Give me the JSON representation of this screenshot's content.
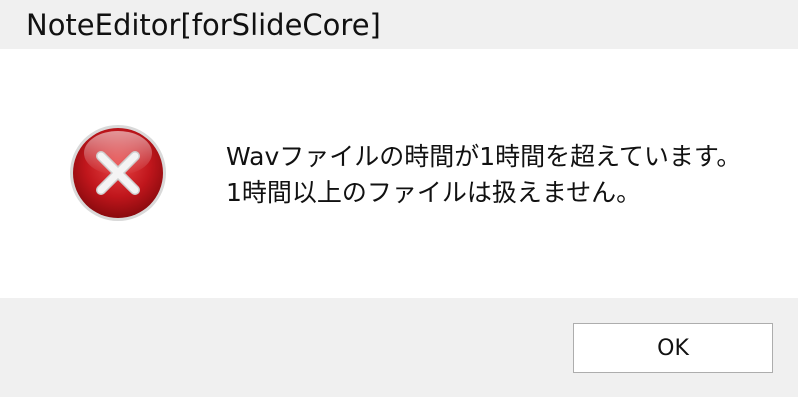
{
  "window": {
    "title": "NoteEditor[forSlideCore]"
  },
  "message": {
    "line1": "Wavファイルの時間が1時間を超えています。",
    "line2": "1時間以上のファイルは扱えません。"
  },
  "buttons": {
    "ok_label": "OK"
  },
  "icon": {
    "name": "error-icon",
    "color": "#c0161c"
  }
}
